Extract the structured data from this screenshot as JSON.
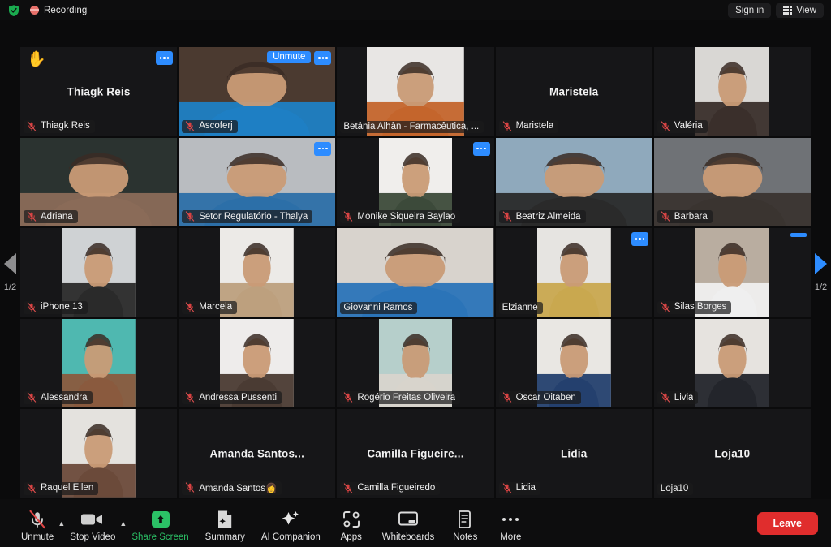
{
  "topbar": {
    "shield_icon": "shield-check-icon",
    "recording_icon": "recording-indicator-icon",
    "recording_label": "Recording",
    "signin_label": "Sign in",
    "view_label": "View",
    "view_icon": "grid-view-icon"
  },
  "gallery": {
    "pager_left": {
      "icon": "chevron-left-icon",
      "page": "1/2"
    },
    "pager_right": {
      "icon": "chevron-right-icon",
      "page": "1/2"
    },
    "tiles": [
      {
        "name": "Thiagk Reis",
        "plate": "Thiagk Reis",
        "muted": true,
        "video": false,
        "center_name": true,
        "hand": "✋",
        "more": true
      },
      {
        "name": "Ascoferj",
        "plate": "Ascoferj",
        "muted": true,
        "video": true,
        "center_name": false,
        "unmute": "Unmute",
        "more": true,
        "style": "fill",
        "bg": "#4b3a30",
        "fg": "#1e7fc4"
      },
      {
        "name": "Betânia Alhàn - Farmacêutica, ...",
        "plate": "Betânia Alhàn - Farmacêutica, ...",
        "muted": false,
        "video": true,
        "center_name": false,
        "style": "pillar",
        "bg": "#e8e6e4",
        "fg": "#c4652c"
      },
      {
        "name": "Maristela",
        "plate": "Maristela",
        "muted": true,
        "video": false,
        "center_name": true
      },
      {
        "name": "Valéria",
        "plate": "Valéria",
        "muted": true,
        "video": true,
        "center_name": false,
        "style": "portrait",
        "bg": "#d9d7d4",
        "fg": "#3a2f2b"
      },
      {
        "name": "Adriana",
        "plate": "Adriana",
        "muted": true,
        "video": true,
        "center_name": false,
        "style": "fill",
        "bg": "#2b3330",
        "fg": "#8a6b58"
      },
      {
        "name": "Setor Regulatório - Thalya",
        "plate": "Setor Regulatório - Thalya",
        "muted": true,
        "video": true,
        "center_name": false,
        "more": true,
        "style": "fill",
        "bg": "#b9bcc0",
        "fg": "#2c6fa8"
      },
      {
        "name": "Monike Siqueira Baylao",
        "plate": "Monike Siqueira Baylao",
        "muted": true,
        "video": true,
        "center_name": false,
        "more": true,
        "style": "portrait",
        "bg": "#f0eeec",
        "fg": "#3c4a3a"
      },
      {
        "name": "Beatriz Almeida",
        "plate": "Beatriz Almeida",
        "muted": true,
        "video": true,
        "center_name": false,
        "style": "fill",
        "bg": "#8fa9bc",
        "fg": "#2a2a2a"
      },
      {
        "name": "Barbara",
        "plate": "Barbara",
        "muted": true,
        "video": true,
        "center_name": false,
        "style": "fill",
        "bg": "#6f7276",
        "fg": "#3a3430"
      },
      {
        "name": "iPhone 13",
        "plate": "iPhone 13",
        "muted": true,
        "video": true,
        "center_name": false,
        "style": "portrait",
        "bg": "#cfd2d4",
        "fg": "#2a2a2a"
      },
      {
        "name": "Marcela",
        "plate": "Marcela",
        "muted": true,
        "video": true,
        "center_name": false,
        "style": "portrait",
        "bg": "#eceae7",
        "fg": "#bda07e"
      },
      {
        "name": "Giovanni Ramos",
        "plate": "Giovanni Ramos",
        "muted": false,
        "video": true,
        "center_name": false,
        "style": "fill",
        "bg": "#d8d3cd",
        "fg": "#2b74b8"
      },
      {
        "name": "Elzianne",
        "plate": "Elzianne",
        "muted": false,
        "video": true,
        "center_name": false,
        "active": true,
        "more": true,
        "style": "portrait",
        "bg": "#e6e4e1",
        "fg": "#c9a84f"
      },
      {
        "name": "Silas Borges",
        "plate": "Silas Borges",
        "muted": true,
        "video": true,
        "center_name": false,
        "blue_bar": true,
        "style": "portrait",
        "bg": "#b9ada0",
        "fg": "#efefef"
      },
      {
        "name": "Alessandra",
        "plate": "Alessandra",
        "muted": true,
        "video": true,
        "center_name": false,
        "style": "portrait",
        "bg": "#4fb8b0",
        "fg": "#8a5a3e"
      },
      {
        "name": "Andressa Pussenti",
        "plate": "Andressa Pussenti",
        "muted": true,
        "video": true,
        "center_name": false,
        "style": "portrait",
        "bg": "#eeeceb",
        "fg": "#4a3b33"
      },
      {
        "name": "Rogério Freitas Oliveira",
        "plate": "Rogério Freitas Oliveira",
        "muted": true,
        "video": true,
        "center_name": false,
        "style": "portrait",
        "bg": "#b6cfcb",
        "fg": "#d8d4cc"
      },
      {
        "name": "Oscar Oitaben",
        "plate": "Oscar Oitaben",
        "muted": true,
        "video": true,
        "center_name": false,
        "style": "portrait",
        "bg": "#e9e7e3",
        "fg": "#24406e"
      },
      {
        "name": "Livia",
        "plate": "Livia",
        "muted": true,
        "video": true,
        "center_name": false,
        "style": "portrait",
        "bg": "#e6e3df",
        "fg": "#23252b"
      },
      {
        "name": "Raquel Ellen",
        "plate": "Raquel Ellen",
        "muted": true,
        "video": true,
        "center_name": false,
        "style": "portrait",
        "bg": "#e4e2de",
        "fg": "#6b4a3a"
      },
      {
        "name": "Amanda Santos...",
        "plate": "Amanda Santos👩",
        "muted": true,
        "video": false,
        "center_name": true
      },
      {
        "name": "Camilla Figueire...",
        "plate": "Camilla Figueiredo",
        "muted": true,
        "video": false,
        "center_name": true
      },
      {
        "name": "Lidia",
        "plate": "Lidia",
        "muted": true,
        "video": false,
        "center_name": true
      },
      {
        "name": "Loja10",
        "plate": "Loja10",
        "muted": false,
        "video": false,
        "center_name": true
      }
    ]
  },
  "toolbar": {
    "items": [
      {
        "label": "Unmute",
        "icon": "microphone-off-icon",
        "caret": true,
        "accent": ""
      },
      {
        "label": "Stop Video",
        "icon": "video-camera-icon",
        "caret": true,
        "accent": ""
      },
      {
        "label": "Share Screen",
        "icon": "share-screen-icon",
        "caret": false,
        "accent": "green"
      },
      {
        "label": "Summary",
        "icon": "summary-doc-icon",
        "caret": false,
        "accent": ""
      },
      {
        "label": "AI Companion",
        "icon": "ai-sparkle-icon",
        "caret": false,
        "accent": ""
      },
      {
        "label": "Apps",
        "icon": "apps-icon",
        "caret": false,
        "accent": ""
      },
      {
        "label": "Whiteboards",
        "icon": "whiteboard-icon",
        "caret": false,
        "accent": ""
      },
      {
        "label": "Notes",
        "icon": "notes-icon",
        "caret": false,
        "accent": ""
      },
      {
        "label": "More",
        "icon": "more-ellipsis-icon",
        "caret": false,
        "accent": ""
      }
    ],
    "leave_label": "Leave",
    "accent_green": "#2bc166",
    "accent_red": "#e02d2d",
    "accent_blue": "#2d8cff"
  }
}
